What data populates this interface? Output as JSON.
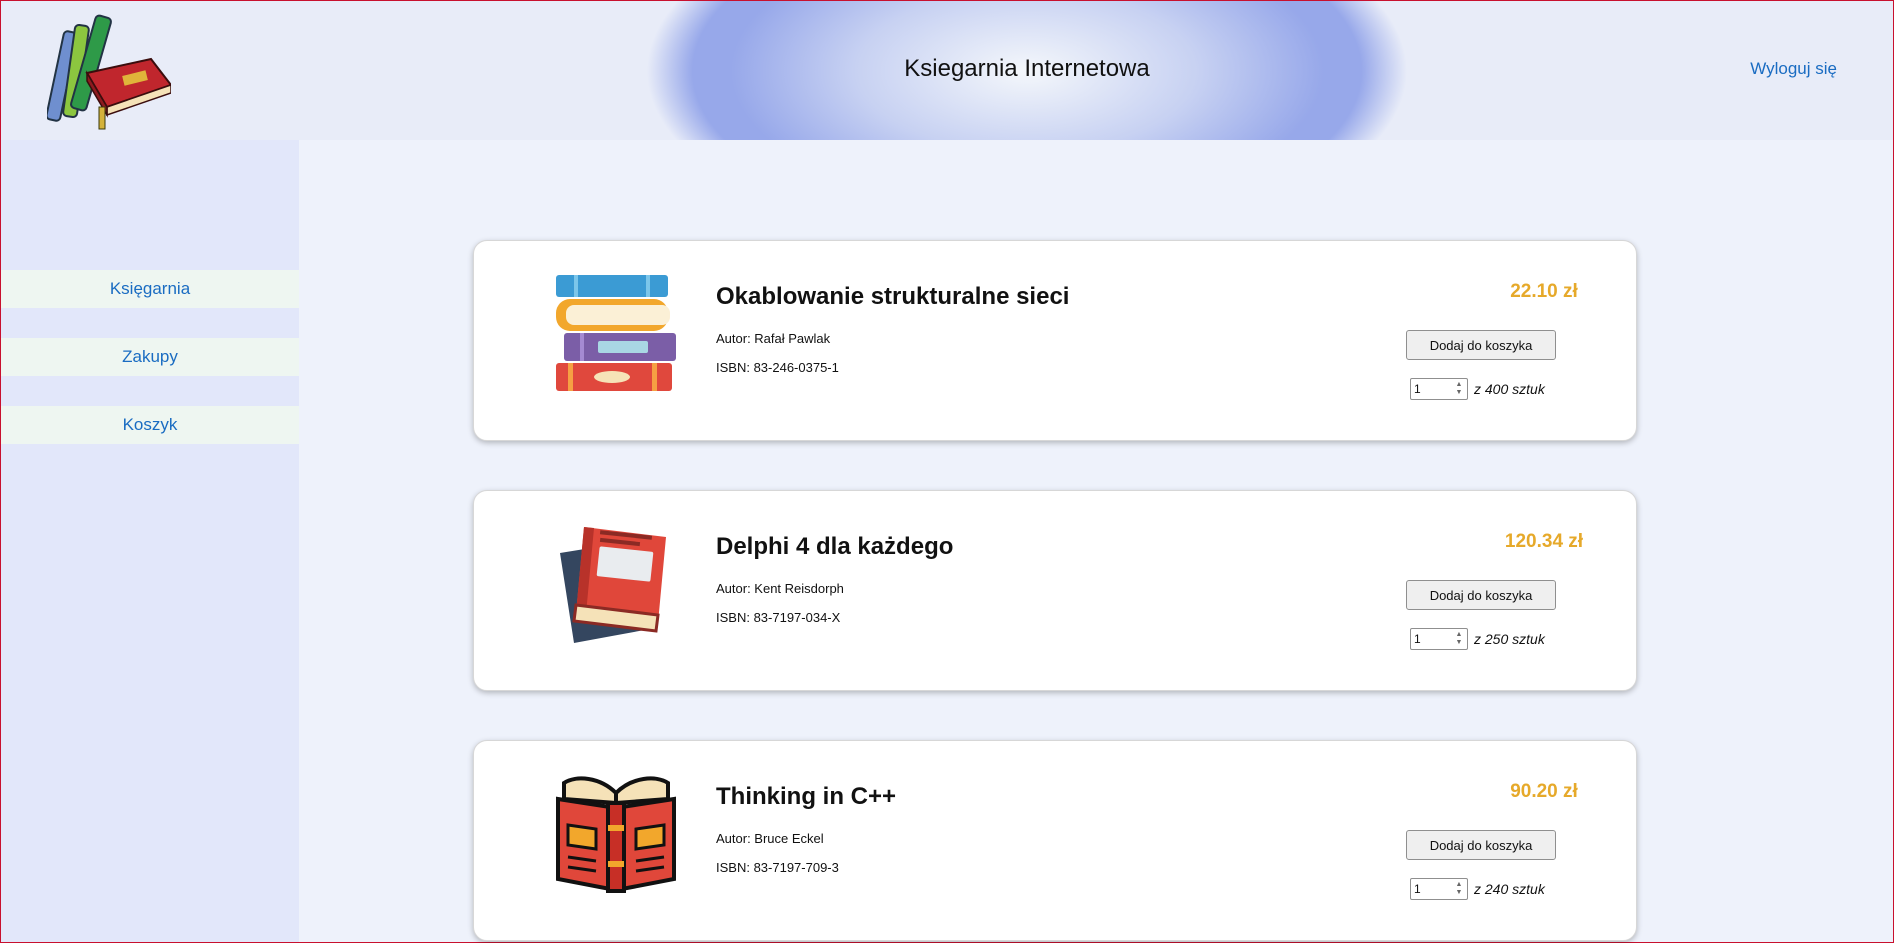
{
  "header": {
    "title": "Ksiegarnia Internetowa",
    "logout": "Wyloguj się"
  },
  "sidebar": {
    "items": [
      {
        "label": "Księgarnia"
      },
      {
        "label": "Zakupy"
      },
      {
        "label": "Koszyk"
      }
    ]
  },
  "books": [
    {
      "title": "Okablowanie strukturalne sieci",
      "author": "Autor: Rafał Pawlak",
      "isbn": "ISBN: 83-246-0375-1",
      "price": "22.10 zł",
      "button": "Dodaj do koszyka",
      "qty": "1",
      "stock": "z 400 sztuk",
      "icon": "stacked-books-icon"
    },
    {
      "title": "Delphi 4 dla każdego",
      "author": "Autor: Kent Reisdorph",
      "isbn": "ISBN: 83-7197-034-X",
      "price": "120.34 zł",
      "button": "Dodaj do koszyka",
      "qty": "1",
      "stock": "z 250 sztuk",
      "icon": "red-book-icon"
    },
    {
      "title": "Thinking in C++",
      "author": "Autor: Bruce Eckel",
      "isbn": "ISBN: 83-7197-709-3",
      "price": "90.20 zł",
      "button": "Dodaj do koszyka",
      "qty": "1",
      "stock": "z 240 sztuk",
      "icon": "open-book-icon"
    }
  ],
  "colors": {
    "price": "#e6a92a",
    "link": "#1a6cc2",
    "header_blue": "#97a8ea"
  }
}
